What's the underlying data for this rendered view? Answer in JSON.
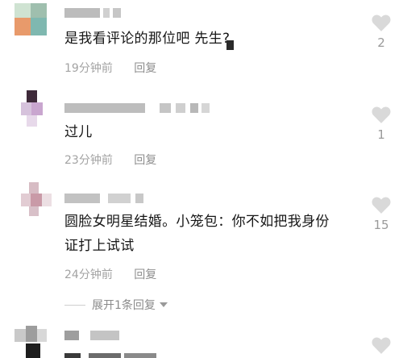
{
  "comments": [
    {
      "text": "是我看评论的那位吧  先生?",
      "time": "19分钟前",
      "reply": "回复",
      "likes": "2"
    },
    {
      "text": "过儿",
      "time": "23分钟前",
      "reply": "回复",
      "likes": "1"
    },
    {
      "text_line1": "圆脸女明星结婚。小笼包：你不如把我身份",
      "text_line2": "证打上试试",
      "time": "24分钟前",
      "reply": "回复",
      "likes": "15"
    }
  ],
  "expand_replies": "展开1条回复",
  "colors": {
    "meta_text": "#a3a3a3",
    "heart": "#d9d9d9",
    "count": "#9a9a9a"
  }
}
